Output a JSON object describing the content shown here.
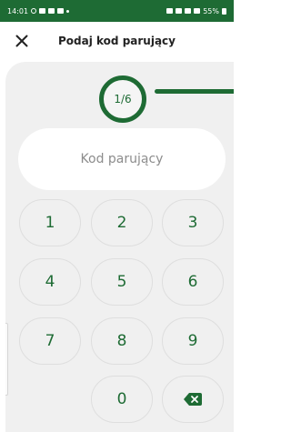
{
  "status_bar": {
    "time": "14:01",
    "battery": "55%"
  },
  "header": {
    "title": "Podaj kod parujący"
  },
  "stepper": {
    "label": "1/6"
  },
  "code_field": {
    "placeholder": "Kod parujący"
  },
  "keypad": {
    "keys": [
      "1",
      "2",
      "3",
      "4",
      "5",
      "6",
      "7",
      "8",
      "9",
      "0"
    ]
  },
  "colors": {
    "brand": "#1e6b34",
    "panel_bg": "#f0f0f0"
  },
  "icons": {
    "close": "close-icon",
    "backspace": "backspace-icon"
  }
}
